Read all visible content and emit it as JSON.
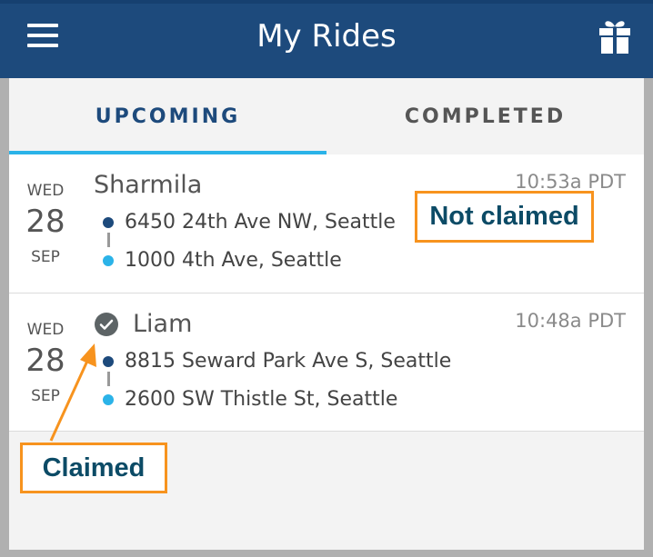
{
  "app": {
    "title": "My Rides",
    "icons": {
      "menu": "hamburger-menu-icon",
      "gift": "gift-icon"
    }
  },
  "tabs": [
    {
      "label": "UPCOMING",
      "active": true
    },
    {
      "label": "COMPLETED",
      "active": false
    }
  ],
  "rides": [
    {
      "dow": "WED",
      "day": "28",
      "month": "SEP",
      "rider": "Sharmila",
      "time": "10:53a PDT",
      "pickup": "6450 24th Ave NW, Seattle",
      "dropoff": "1000 4th Ave, Seattle",
      "claimed": false
    },
    {
      "dow": "WED",
      "day": "28",
      "month": "SEP",
      "rider": "Liam",
      "time": "10:48a PDT",
      "pickup": "8815 Seward Park Ave S, Seattle",
      "dropoff": "2600 SW Thistle St, Seattle",
      "claimed": true
    }
  ],
  "annotations": {
    "not_claimed": "Not claimed",
    "claimed": "Claimed"
  },
  "colors": {
    "appbar": "#1d4a7c",
    "accent": "#2bb3e8",
    "callout_border": "#f7931e",
    "callout_text": "#0c4b66"
  }
}
